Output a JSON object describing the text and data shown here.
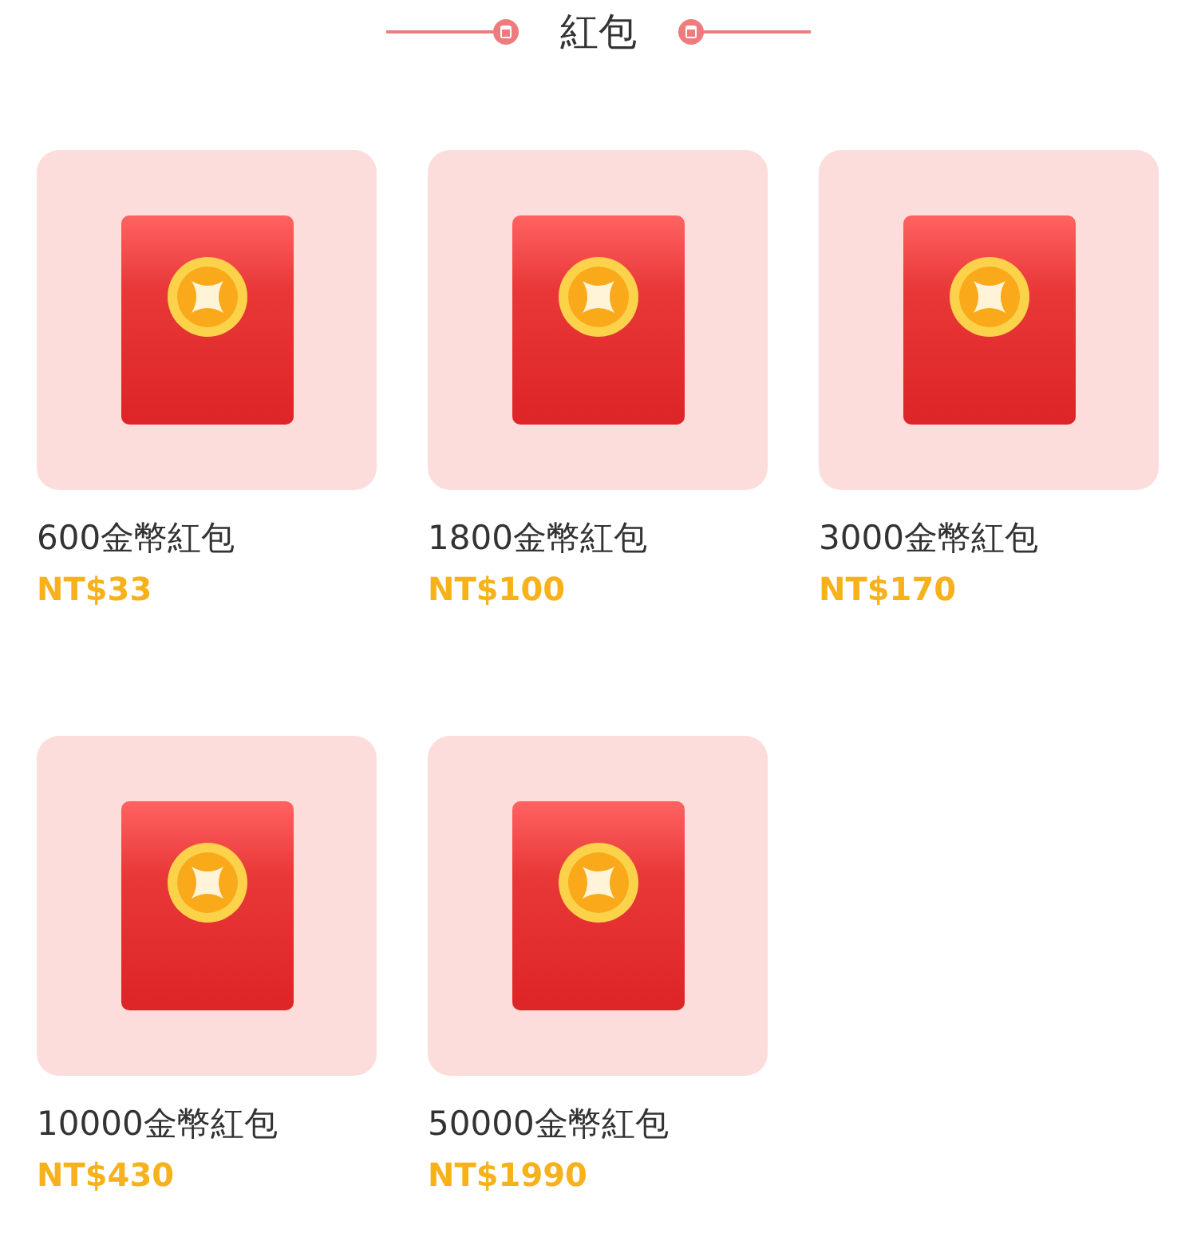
{
  "section": {
    "title": "紅包"
  },
  "products": [
    {
      "name": "600金幣紅包",
      "price": "NT$33"
    },
    {
      "name": "1800金幣紅包",
      "price": "NT$100"
    },
    {
      "name": "3000金幣紅包",
      "price": "NT$170"
    },
    {
      "name": "10000金幣紅包",
      "price": "NT$430"
    },
    {
      "name": "50000金幣紅包",
      "price": "NT$1990"
    }
  ]
}
